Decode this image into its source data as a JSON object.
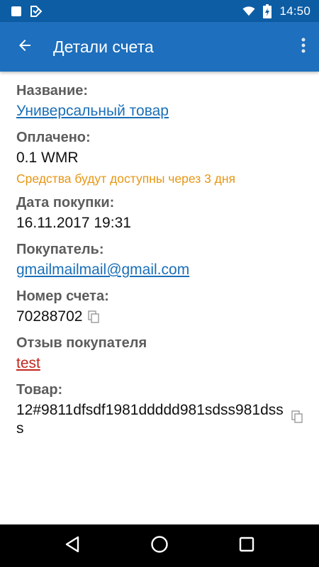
{
  "status_bar": {
    "time": "14:50",
    "icons": [
      "square-notification-icon",
      "check-notification-icon",
      "wifi-icon",
      "battery-icon"
    ]
  },
  "toolbar": {
    "title": "Детали счета",
    "back_icon": "arrow-back-icon",
    "overflow_icon": "more-vert-icon"
  },
  "details": {
    "name_label": "Название:",
    "name_value": "Универсальный товар",
    "paid_label": "Оплачено:",
    "paid_value": "0.1 WMR",
    "paid_note": "Средства будут доступны через 3 дня",
    "date_label": "Дата покупки:",
    "date_value": "16.11.2017 19:31",
    "buyer_label": "Покупатель:",
    "buyer_value": "gmailmailmail@gmail.com",
    "invoice_label": "Номер счета:",
    "invoice_value": "70288702",
    "review_label": "Отзыв покупателя",
    "review_value": "test",
    "product_label": "Товар:",
    "product_value": "12#9811dfsdf1981ddddd981sdss981dsss"
  },
  "colors": {
    "status_bar": "#0d5da4",
    "toolbar": "#1e6fbd",
    "link": "#1a6fb8",
    "warning": "#e89612",
    "review_link": "#c1271c"
  },
  "nav_bar": {
    "icons": [
      "back-triangle-icon",
      "home-circle-icon",
      "recents-square-icon"
    ]
  }
}
